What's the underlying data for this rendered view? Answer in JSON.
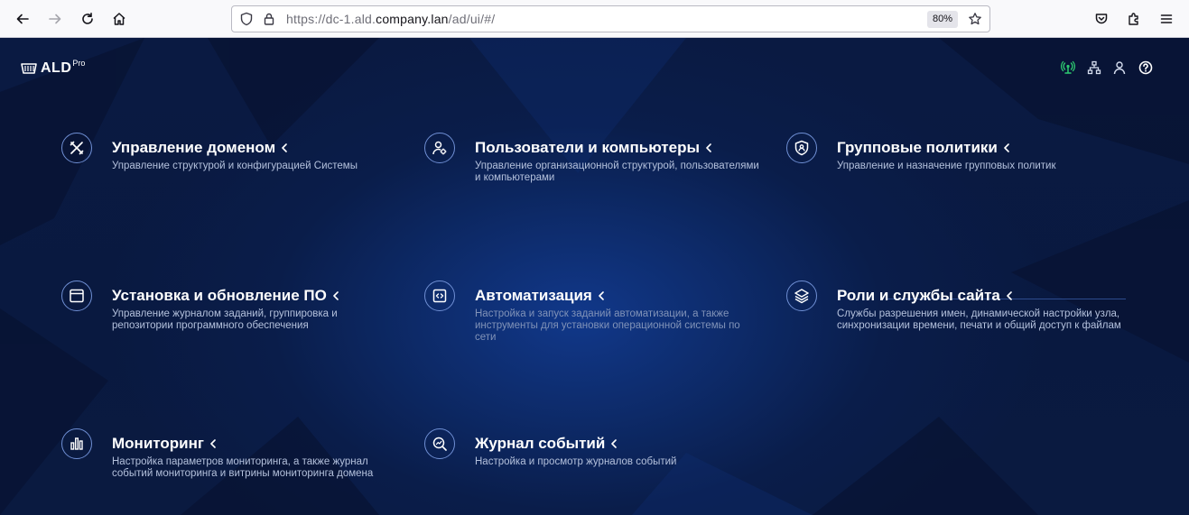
{
  "browser": {
    "url_prefix": "https://dc-1.ald.",
    "url_host": "company.lan",
    "url_path": "/ad/ui/#/",
    "zoom": "80%",
    "icons": [
      "back-icon",
      "forward-icon",
      "reload-icon",
      "home-icon",
      "shield-icon",
      "lock-icon",
      "star-icon",
      "pocket-icon",
      "extensions-icon",
      "menu-icon"
    ]
  },
  "app": {
    "logo_text": "ALD",
    "logo_sup": "Pro",
    "status_color": "#2ecc71",
    "accent_color": "#6f8fd4"
  },
  "tiles": [
    {
      "title": "Управление доменом",
      "desc": "Управление структурой и конфигурацией Системы",
      "icon": "tools-icon"
    },
    {
      "title": "Пользователи и компьютеры",
      "desc": "Управление организационной структурой, пользователями и компьютерами",
      "icon": "user-settings-icon"
    },
    {
      "title": "Групповые политики",
      "desc": "Управление и назначение групповых политик",
      "icon": "shield-user-icon"
    },
    {
      "title": "Установка и обновление ПО",
      "desc": "Управление журналом заданий, группировка и репозитории программного обеспечения",
      "icon": "window-icon"
    },
    {
      "title": "Автоматизация",
      "desc": "Настройка и запуск заданий автоматизации, а также инструменты для установки операционной системы по сети",
      "icon": "code-window-icon"
    },
    {
      "title": "Роли и службы сайта",
      "desc": "Службы разрешения имен, динамической настройки узла, синхронизации времени, печати и общий доступ к файлам",
      "icon": "layers-icon"
    },
    {
      "title": "Мониторинг",
      "desc": "Настройка параметров мониторинга, а также журнал событий мониторинга и витрины мониторинга домена",
      "icon": "bar-chart-icon"
    },
    {
      "title": "Журнал событий",
      "desc": "Настройка и просмотр журналов событий",
      "icon": "search-log-icon"
    }
  ]
}
